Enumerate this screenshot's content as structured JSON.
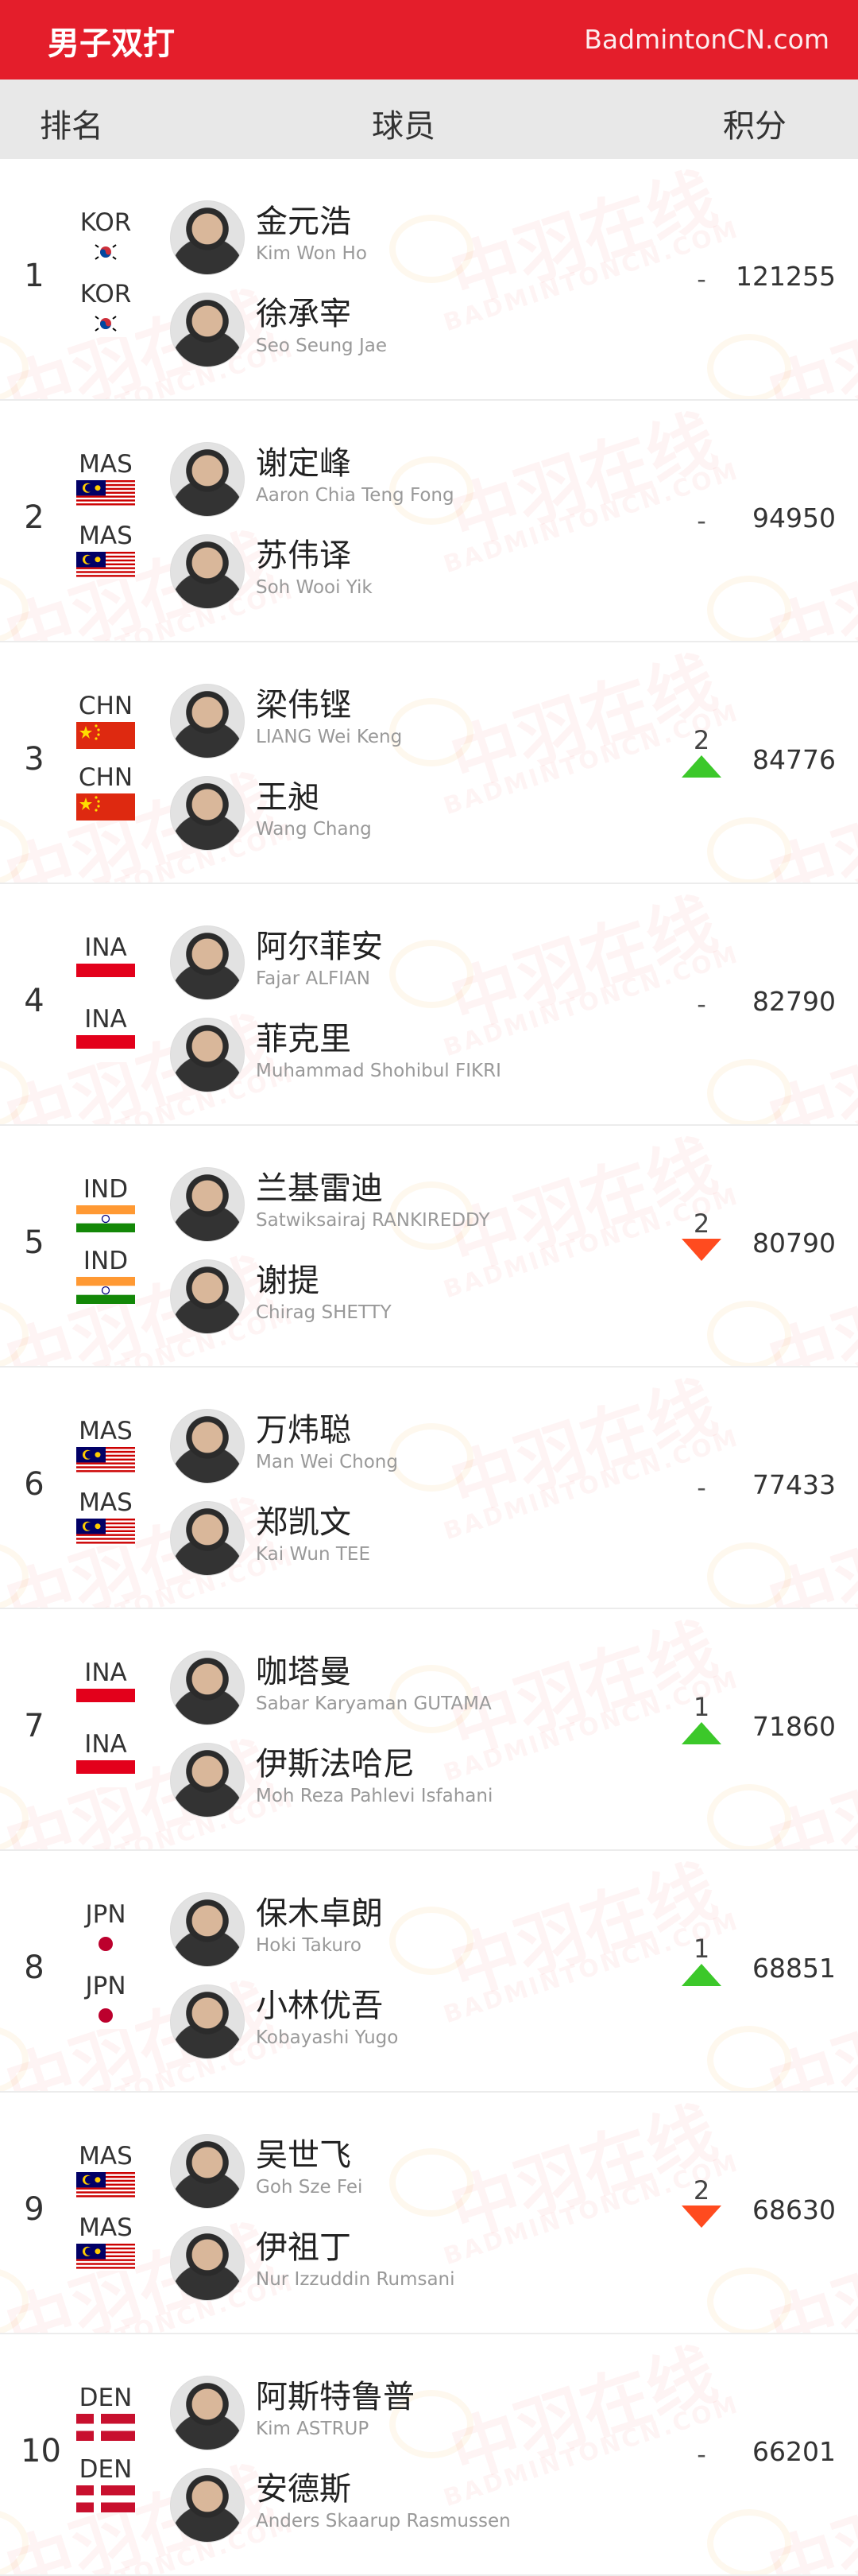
{
  "header": {
    "title": "男子双打",
    "site": "BadmintonCN.com"
  },
  "columns": {
    "rank": "排名",
    "players": "球员",
    "points": "积分"
  },
  "watermark": {
    "logo": "中羽在线",
    "url": "BADMINTONCN.COM"
  },
  "colors": {
    "brand_red": "#e41e2b",
    "up": "#3cc82a",
    "down": "#ff4b1f"
  },
  "rows": [
    {
      "rank": "1",
      "points": "121255",
      "change": "-",
      "change_dir": "none",
      "players": [
        {
          "country": "KOR",
          "flag": "kor",
          "name_cn": "金元浩",
          "name_en": "Kim Won Ho"
        },
        {
          "country": "KOR",
          "flag": "kor",
          "name_cn": "徐承宰",
          "name_en": "Seo Seung Jae"
        }
      ]
    },
    {
      "rank": "2",
      "points": "94950",
      "change": "-",
      "change_dir": "none",
      "players": [
        {
          "country": "MAS",
          "flag": "mas",
          "name_cn": "谢定峰",
          "name_en": "Aaron Chia Teng Fong"
        },
        {
          "country": "MAS",
          "flag": "mas",
          "name_cn": "苏伟译",
          "name_en": "Soh Wooi Yik"
        }
      ]
    },
    {
      "rank": "3",
      "points": "84776",
      "change": "2",
      "change_dir": "up",
      "players": [
        {
          "country": "CHN",
          "flag": "chn",
          "name_cn": "梁伟铿",
          "name_en": "LIANG Wei Keng"
        },
        {
          "country": "CHN",
          "flag": "chn",
          "name_cn": "王昶",
          "name_en": "Wang Chang"
        }
      ]
    },
    {
      "rank": "4",
      "points": "82790",
      "change": "-",
      "change_dir": "none",
      "players": [
        {
          "country": "INA",
          "flag": "ina",
          "name_cn": "阿尔菲安",
          "name_en": "Fajar ALFIAN"
        },
        {
          "country": "INA",
          "flag": "ina",
          "name_cn": "菲克里",
          "name_en": "Muhammad Shohibul FIKRI"
        }
      ]
    },
    {
      "rank": "5",
      "points": "80790",
      "change": "2",
      "change_dir": "down",
      "players": [
        {
          "country": "IND",
          "flag": "ind",
          "name_cn": "兰基雷迪",
          "name_en": "Satwiksairaj RANKIREDDY"
        },
        {
          "country": "IND",
          "flag": "ind",
          "name_cn": "谢提",
          "name_en": "Chirag SHETTY"
        }
      ]
    },
    {
      "rank": "6",
      "points": "77433",
      "change": "-",
      "change_dir": "none",
      "players": [
        {
          "country": "MAS",
          "flag": "mas",
          "name_cn": "万炜聪",
          "name_en": "Man Wei Chong"
        },
        {
          "country": "MAS",
          "flag": "mas",
          "name_cn": "郑凯文",
          "name_en": "Kai Wun TEE"
        }
      ]
    },
    {
      "rank": "7",
      "points": "71860",
      "change": "1",
      "change_dir": "up",
      "players": [
        {
          "country": "INA",
          "flag": "ina",
          "name_cn": "咖塔曼",
          "name_en": "Sabar Karyaman GUTAMA"
        },
        {
          "country": "INA",
          "flag": "ina",
          "name_cn": "伊斯法哈尼",
          "name_en": "Moh Reza Pahlevi Isfahani"
        }
      ]
    },
    {
      "rank": "8",
      "points": "68851",
      "change": "1",
      "change_dir": "up",
      "players": [
        {
          "country": "JPN",
          "flag": "jpn",
          "name_cn": "保木卓朗",
          "name_en": "Hoki Takuro"
        },
        {
          "country": "JPN",
          "flag": "jpn",
          "name_cn": "小林优吾",
          "name_en": "Kobayashi Yugo"
        }
      ]
    },
    {
      "rank": "9",
      "points": "68630",
      "change": "2",
      "change_dir": "down",
      "players": [
        {
          "country": "MAS",
          "flag": "mas",
          "name_cn": "吴世飞",
          "name_en": "Goh Sze Fei"
        },
        {
          "country": "MAS",
          "flag": "mas",
          "name_cn": "伊祖丁",
          "name_en": "Nur Izzuddin Rumsani"
        }
      ]
    },
    {
      "rank": "10",
      "points": "66201",
      "change": "-",
      "change_dir": "none",
      "players": [
        {
          "country": "DEN",
          "flag": "den",
          "name_cn": "阿斯特鲁普",
          "name_en": "Kim ASTRUP"
        },
        {
          "country": "DEN",
          "flag": "den",
          "name_cn": "安德斯",
          "name_en": "Anders Skaarup Rasmussen"
        }
      ]
    }
  ]
}
